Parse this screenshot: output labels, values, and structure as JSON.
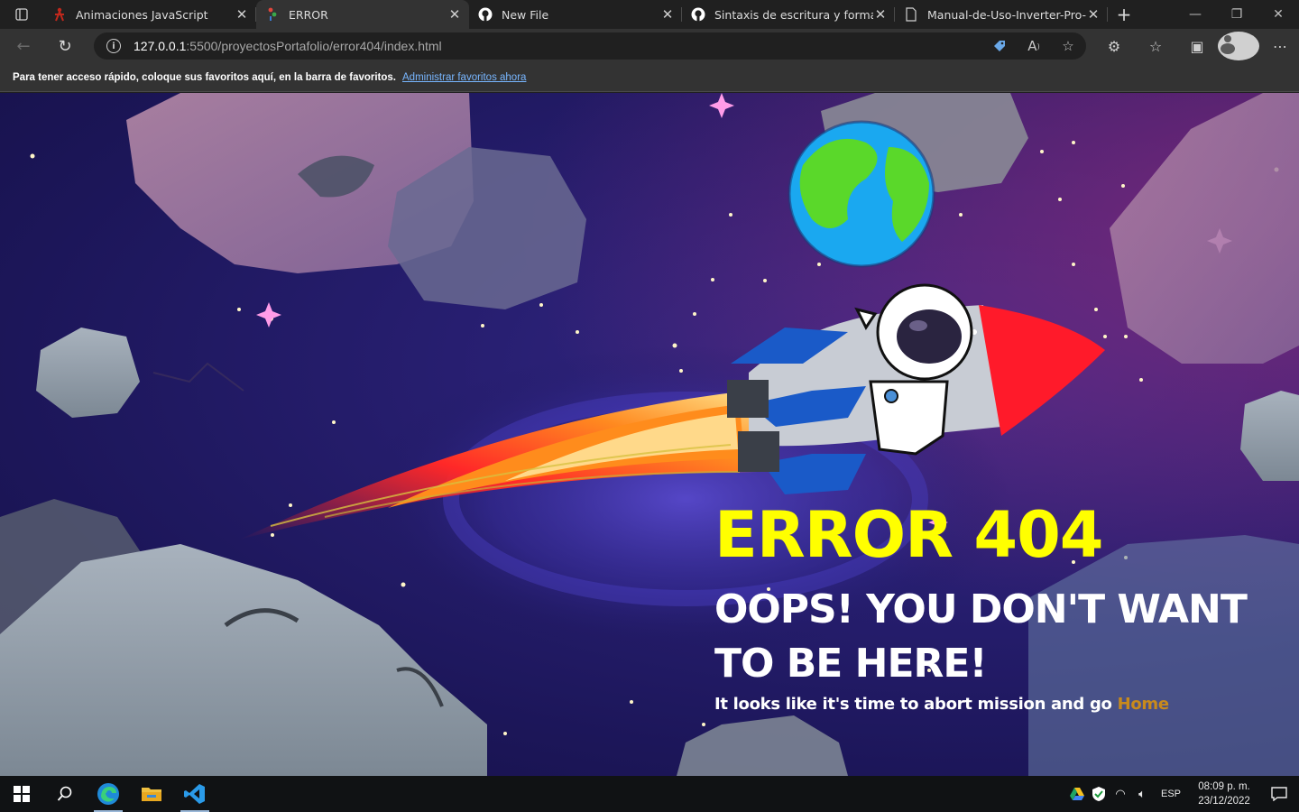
{
  "browser": {
    "tabs": [
      {
        "title": "Animaciones JavaScript",
        "favicon": "red-figure-icon",
        "active": false
      },
      {
        "title": "ERROR",
        "favicon": "vscode-live-server-icon",
        "active": true
      },
      {
        "title": "New File",
        "favicon": "github-icon",
        "active": false
      },
      {
        "title": "Sintaxis de escritura y formato b",
        "favicon": "github-icon",
        "active": false
      },
      {
        "title": "Manual-de-Uso-Inverter-Pro-21",
        "favicon": "document-icon",
        "active": false
      }
    ],
    "address": {
      "host": "127.0.0.1",
      "path": ":5500/proyectosPortafolio/error404/index.html"
    },
    "favorites_bar": {
      "message": "Para tener acceso rápido, coloque sus favoritos aquí, en la barra de favoritos.",
      "link": "Administrar favoritos ahora"
    }
  },
  "page": {
    "title": "ERROR 404",
    "subtitle": "OOPS! YOU DON'T WANT TO BE HERE!",
    "message": "It looks like it's time to abort mission and go",
    "home_link": "Home",
    "colors": {
      "title": "#ffff00",
      "text": "#ffffff",
      "link": "#c88a1c",
      "background": "#281f72"
    }
  },
  "taskbar": {
    "pinned": [
      "windows-start-icon",
      "search-icon",
      "edge-icon",
      "file-explorer-icon",
      "vscode-icon"
    ],
    "language": "ESP",
    "time": "08:09 p. m.",
    "date": "23/12/2022"
  }
}
